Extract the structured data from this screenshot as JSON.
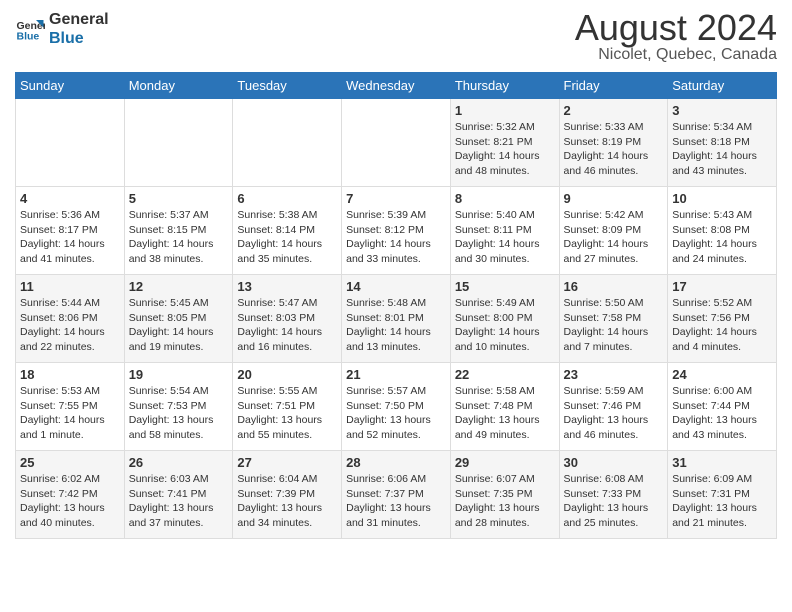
{
  "logo": {
    "line1": "General",
    "line2": "Blue"
  },
  "title": "August 2024",
  "subtitle": "Nicolet, Quebec, Canada",
  "days_header": [
    "Sunday",
    "Monday",
    "Tuesday",
    "Wednesday",
    "Thursday",
    "Friday",
    "Saturday"
  ],
  "weeks": [
    [
      {
        "day": "",
        "info": ""
      },
      {
        "day": "",
        "info": ""
      },
      {
        "day": "",
        "info": ""
      },
      {
        "day": "",
        "info": ""
      },
      {
        "day": "1",
        "info": "Sunrise: 5:32 AM\nSunset: 8:21 PM\nDaylight: 14 hours\nand 48 minutes."
      },
      {
        "day": "2",
        "info": "Sunrise: 5:33 AM\nSunset: 8:19 PM\nDaylight: 14 hours\nand 46 minutes."
      },
      {
        "day": "3",
        "info": "Sunrise: 5:34 AM\nSunset: 8:18 PM\nDaylight: 14 hours\nand 43 minutes."
      }
    ],
    [
      {
        "day": "4",
        "info": "Sunrise: 5:36 AM\nSunset: 8:17 PM\nDaylight: 14 hours\nand 41 minutes."
      },
      {
        "day": "5",
        "info": "Sunrise: 5:37 AM\nSunset: 8:15 PM\nDaylight: 14 hours\nand 38 minutes."
      },
      {
        "day": "6",
        "info": "Sunrise: 5:38 AM\nSunset: 8:14 PM\nDaylight: 14 hours\nand 35 minutes."
      },
      {
        "day": "7",
        "info": "Sunrise: 5:39 AM\nSunset: 8:12 PM\nDaylight: 14 hours\nand 33 minutes."
      },
      {
        "day": "8",
        "info": "Sunrise: 5:40 AM\nSunset: 8:11 PM\nDaylight: 14 hours\nand 30 minutes."
      },
      {
        "day": "9",
        "info": "Sunrise: 5:42 AM\nSunset: 8:09 PM\nDaylight: 14 hours\nand 27 minutes."
      },
      {
        "day": "10",
        "info": "Sunrise: 5:43 AM\nSunset: 8:08 PM\nDaylight: 14 hours\nand 24 minutes."
      }
    ],
    [
      {
        "day": "11",
        "info": "Sunrise: 5:44 AM\nSunset: 8:06 PM\nDaylight: 14 hours\nand 22 minutes."
      },
      {
        "day": "12",
        "info": "Sunrise: 5:45 AM\nSunset: 8:05 PM\nDaylight: 14 hours\nand 19 minutes."
      },
      {
        "day": "13",
        "info": "Sunrise: 5:47 AM\nSunset: 8:03 PM\nDaylight: 14 hours\nand 16 minutes."
      },
      {
        "day": "14",
        "info": "Sunrise: 5:48 AM\nSunset: 8:01 PM\nDaylight: 14 hours\nand 13 minutes."
      },
      {
        "day": "15",
        "info": "Sunrise: 5:49 AM\nSunset: 8:00 PM\nDaylight: 14 hours\nand 10 minutes."
      },
      {
        "day": "16",
        "info": "Sunrise: 5:50 AM\nSunset: 7:58 PM\nDaylight: 14 hours\nand 7 minutes."
      },
      {
        "day": "17",
        "info": "Sunrise: 5:52 AM\nSunset: 7:56 PM\nDaylight: 14 hours\nand 4 minutes."
      }
    ],
    [
      {
        "day": "18",
        "info": "Sunrise: 5:53 AM\nSunset: 7:55 PM\nDaylight: 14 hours\nand 1 minute."
      },
      {
        "day": "19",
        "info": "Sunrise: 5:54 AM\nSunset: 7:53 PM\nDaylight: 13 hours\nand 58 minutes."
      },
      {
        "day": "20",
        "info": "Sunrise: 5:55 AM\nSunset: 7:51 PM\nDaylight: 13 hours\nand 55 minutes."
      },
      {
        "day": "21",
        "info": "Sunrise: 5:57 AM\nSunset: 7:50 PM\nDaylight: 13 hours\nand 52 minutes."
      },
      {
        "day": "22",
        "info": "Sunrise: 5:58 AM\nSunset: 7:48 PM\nDaylight: 13 hours\nand 49 minutes."
      },
      {
        "day": "23",
        "info": "Sunrise: 5:59 AM\nSunset: 7:46 PM\nDaylight: 13 hours\nand 46 minutes."
      },
      {
        "day": "24",
        "info": "Sunrise: 6:00 AM\nSunset: 7:44 PM\nDaylight: 13 hours\nand 43 minutes."
      }
    ],
    [
      {
        "day": "25",
        "info": "Sunrise: 6:02 AM\nSunset: 7:42 PM\nDaylight: 13 hours\nand 40 minutes."
      },
      {
        "day": "26",
        "info": "Sunrise: 6:03 AM\nSunset: 7:41 PM\nDaylight: 13 hours\nand 37 minutes."
      },
      {
        "day": "27",
        "info": "Sunrise: 6:04 AM\nSunset: 7:39 PM\nDaylight: 13 hours\nand 34 minutes."
      },
      {
        "day": "28",
        "info": "Sunrise: 6:06 AM\nSunset: 7:37 PM\nDaylight: 13 hours\nand 31 minutes."
      },
      {
        "day": "29",
        "info": "Sunrise: 6:07 AM\nSunset: 7:35 PM\nDaylight: 13 hours\nand 28 minutes."
      },
      {
        "day": "30",
        "info": "Sunrise: 6:08 AM\nSunset: 7:33 PM\nDaylight: 13 hours\nand 25 minutes."
      },
      {
        "day": "31",
        "info": "Sunrise: 6:09 AM\nSunset: 7:31 PM\nDaylight: 13 hours\nand 21 minutes."
      }
    ]
  ]
}
